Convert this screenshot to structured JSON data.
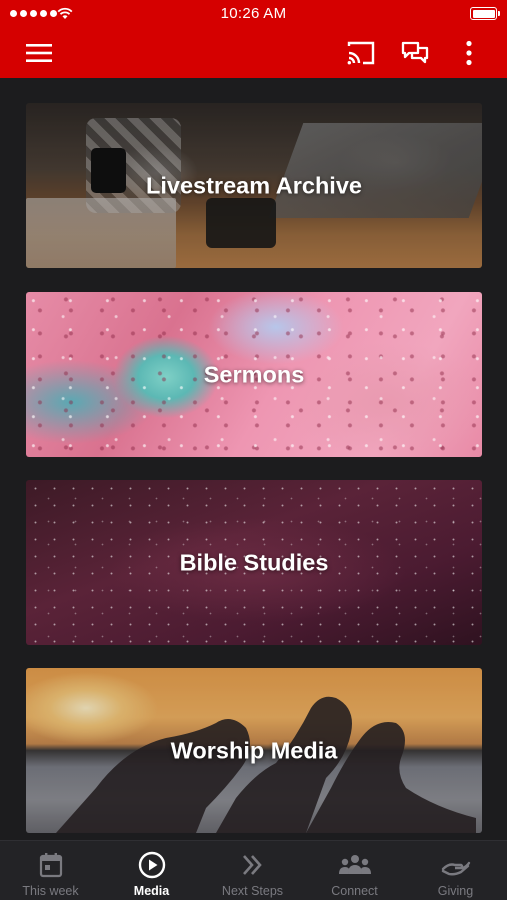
{
  "status_bar": {
    "time": "10:26 AM"
  },
  "app_bar": {
    "background_color": "#d50000",
    "icons": [
      "menu-icon",
      "cast-icon",
      "chat-icon",
      "more-vert-icon"
    ]
  },
  "media_cards": [
    {
      "title": "Livestream Archive",
      "image": "living-room-camera-photo"
    },
    {
      "title": "Sermons",
      "image": "pink-teal-marble-photo"
    },
    {
      "title": "Bible Studies",
      "image": "starry-sky-photo"
    },
    {
      "title": "Worship Media",
      "image": "sunset-heart-hands-photo"
    }
  ],
  "tabs": [
    {
      "label": "This week",
      "icon": "calendar-icon"
    },
    {
      "label": "Media",
      "icon": "play-circle-icon",
      "active": true
    },
    {
      "label": "Next Steps",
      "icon": "chevrons-right-icon"
    },
    {
      "label": "Connect",
      "icon": "people-icon"
    },
    {
      "label": "Giving",
      "icon": "giving-hand-icon"
    }
  ],
  "colors": {
    "accent": "#d50000",
    "background": "#1c1c1e",
    "tab_active": "#ffffff",
    "tab_inactive": "#7a7a80"
  }
}
